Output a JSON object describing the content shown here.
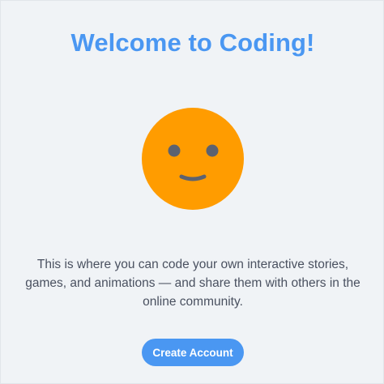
{
  "welcome": {
    "title": "Welcome to Coding!",
    "mascot_icon": "smiley-face-icon",
    "description": "This is where you can code your own interactive stories, games, and animations — and share them with others in the online community.",
    "create_account_label": "Create Account"
  },
  "colors": {
    "background": "#f0f3f6",
    "accent": "#4a97f2",
    "face": "#ff9c00",
    "face_features": "#5c6270",
    "body_text": "#4a5160",
    "button_text": "#ffffff"
  }
}
